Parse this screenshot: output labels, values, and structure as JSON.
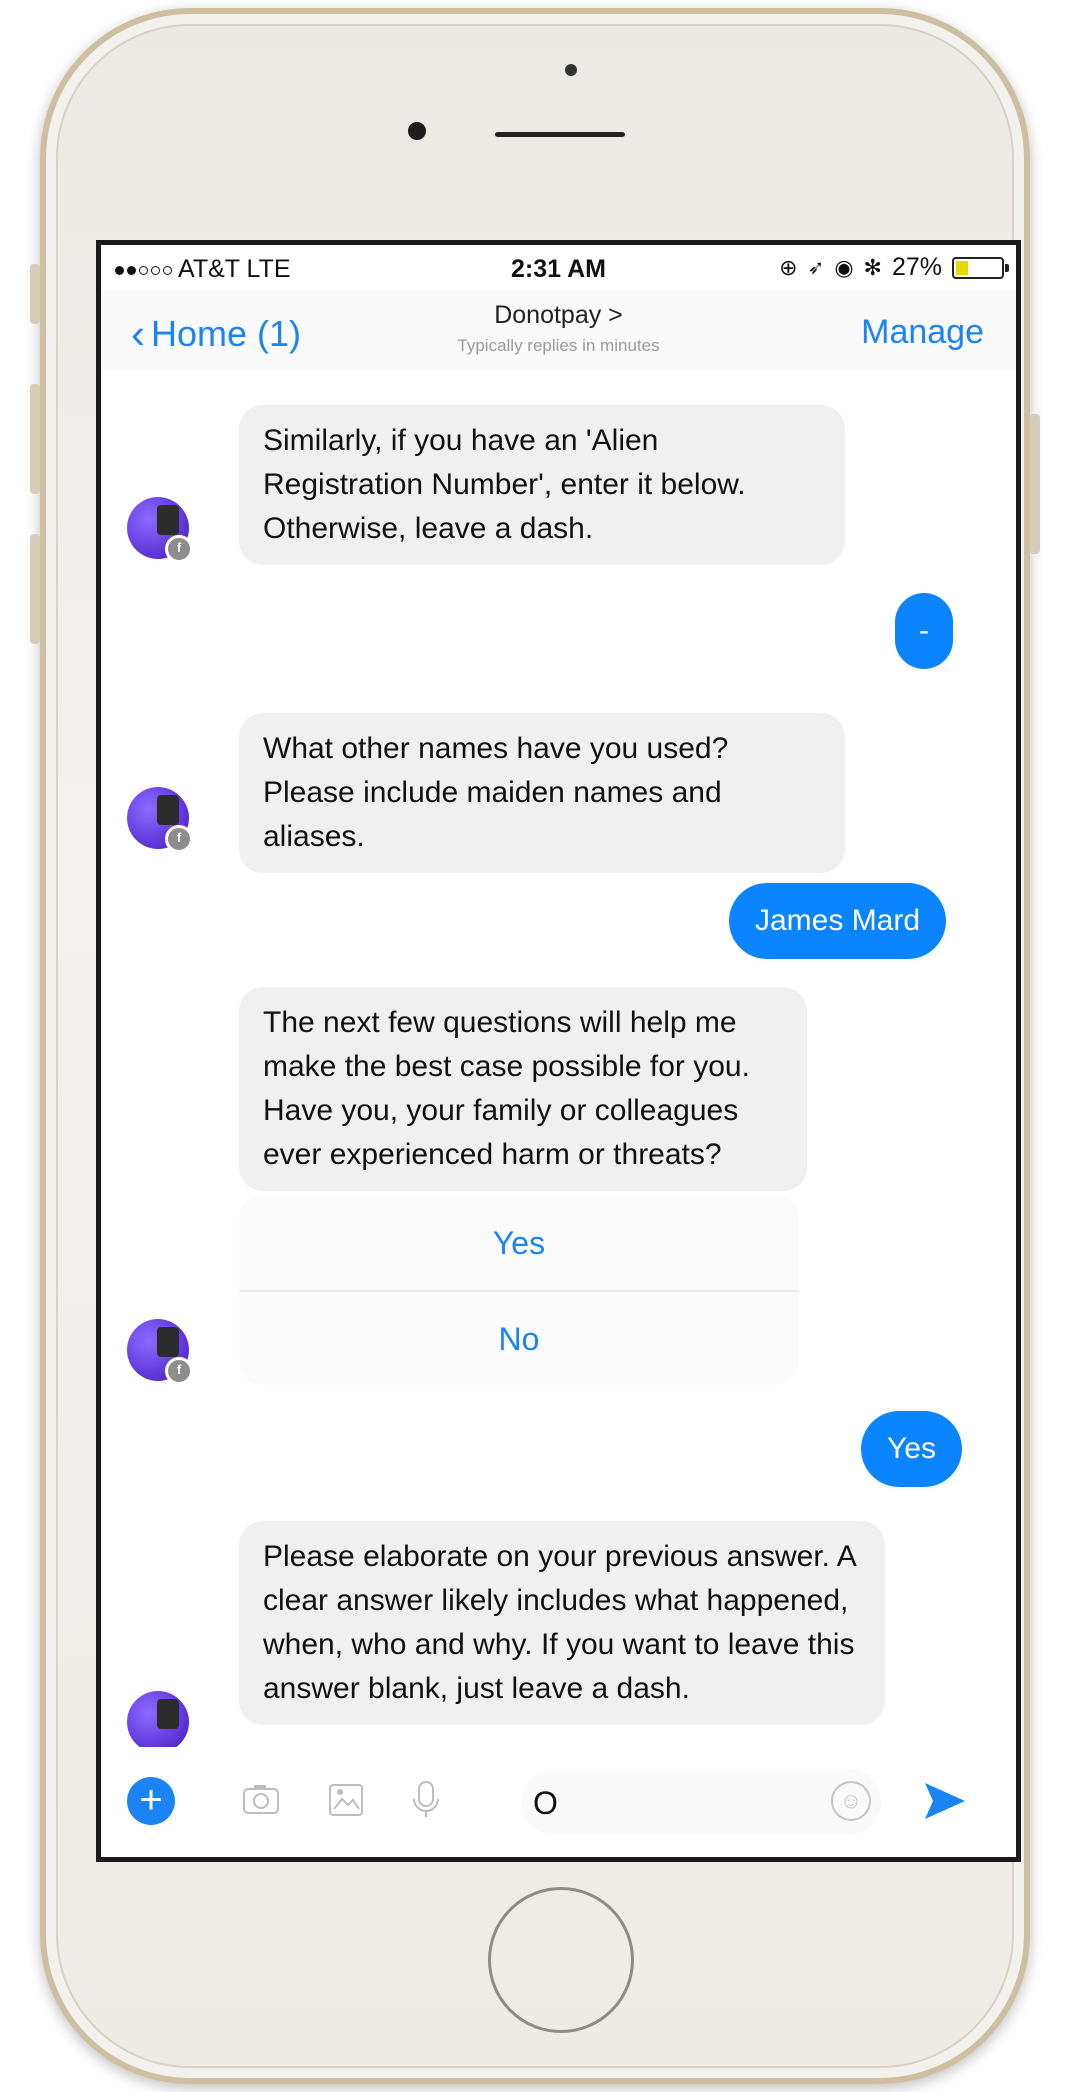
{
  "status_bar": {
    "carrier": "AT&T  LTE",
    "time": "2:31 AM",
    "battery": "27%",
    "battery_level": 0.27
  },
  "nav": {
    "back_label": "Home (1)",
    "title": "Donotpay >",
    "subtitle": "Typically replies in minutes",
    "manage_label": "Manage"
  },
  "messages": [
    {
      "side": "bot",
      "text": "Similarly, if you have an 'Alien Registration Number', enter it below. Otherwise, leave a dash."
    },
    {
      "side": "user",
      "text": "-"
    },
    {
      "side": "bot",
      "text": "What other names have you used? Please include maiden names and aliases."
    },
    {
      "side": "user",
      "text": "James Mard"
    },
    {
      "side": "bot",
      "text": "The next few questions will help me make the best case possible for you. Have you, your family or colleagues ever experienced harm or threats?"
    },
    {
      "side": "user",
      "text": "Yes"
    },
    {
      "side": "bot",
      "text": "Please elaborate on your previous answer. A clear answer likely includes what happened, when, who and why. If you want to leave this answer blank, just leave a dash."
    }
  ],
  "quick_replies": [
    "Yes",
    "No"
  ],
  "composer": {
    "text": "O"
  },
  "colors": {
    "accent": "#1a84f4",
    "user_bubble": "#0a84ff",
    "bot_bubble": "#f0f0f0"
  }
}
